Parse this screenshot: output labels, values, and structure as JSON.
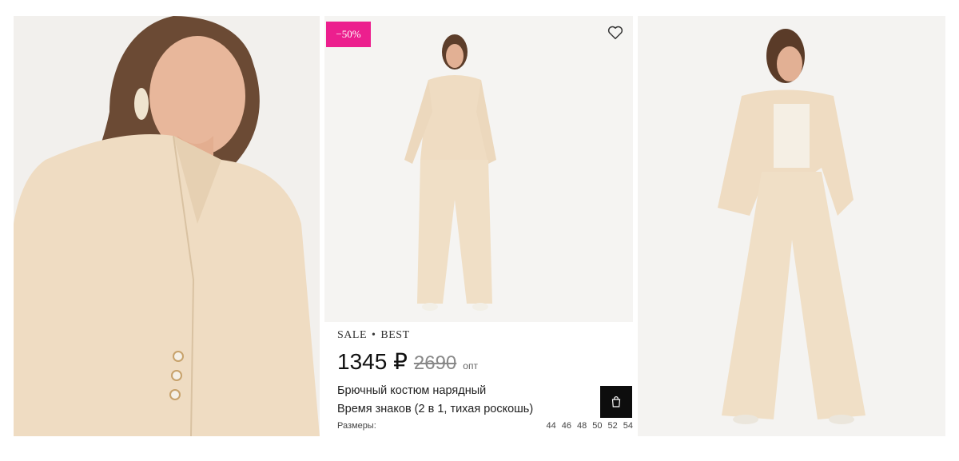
{
  "product": {
    "badge": "−50%",
    "tags": [
      "SALE",
      "BEST"
    ],
    "tag_separator": "•",
    "price_current": "1345 ₽",
    "price_old": "2690",
    "price_suffix": "опт",
    "title_line1": "Брючный костюм нарядный",
    "title_line2": "Время знаков (2 в 1, тихая роскошь)",
    "sizes_label": "Размеры:",
    "sizes": [
      "44",
      "46",
      "48",
      "50",
      "52",
      "54"
    ]
  },
  "icons": {
    "favorite": "heart-icon",
    "cart": "shopping-bag-icon"
  },
  "colors": {
    "badge": "#ec1f8e",
    "cart_button": "#0d0d0d",
    "suit": "#efdcc2"
  }
}
